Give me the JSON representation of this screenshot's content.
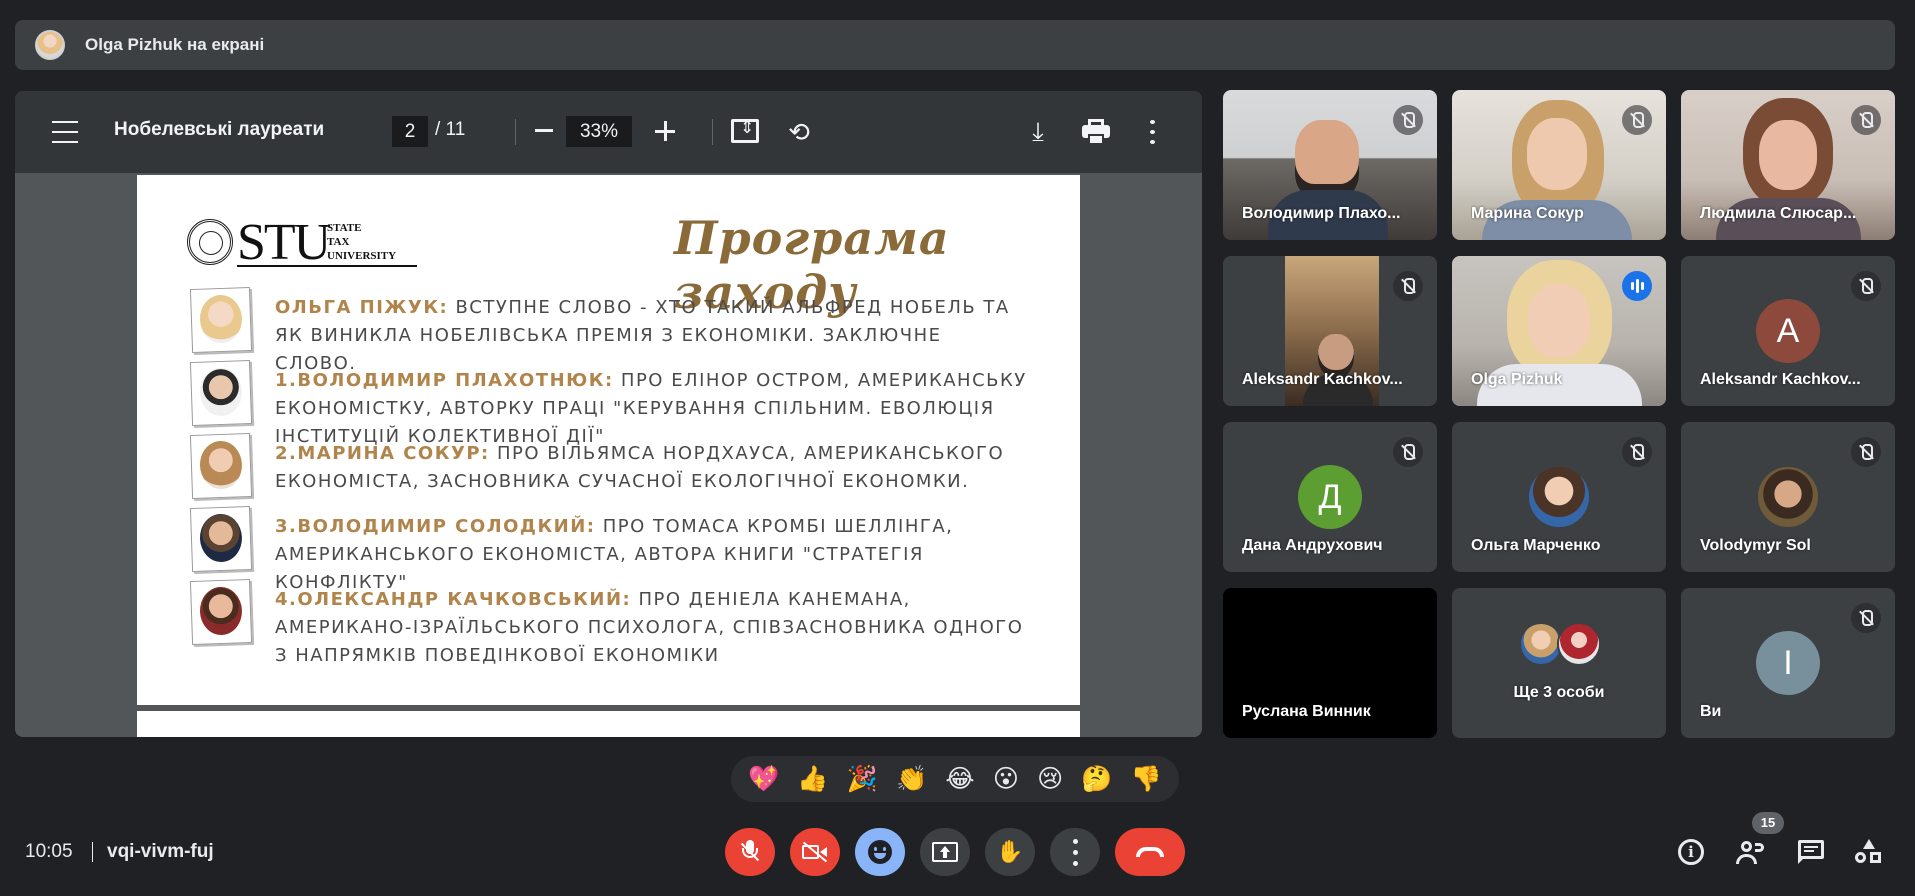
{
  "banner": {
    "text": "Olga Pizhuk на екрані"
  },
  "pdf": {
    "title": "Нобелевські лауреати",
    "page_current": "2",
    "page_total": "/ 11",
    "zoom": "33%",
    "slide": {
      "logo_text": "STU",
      "logo_sub_1": "STATE",
      "logo_sub_2": "TAX",
      "logo_sub_3": "UNIVERSITY",
      "title": "Програма заходу",
      "items": [
        {
          "speaker": "Ольга Піжук:",
          "text": " вступне слово - хто такий Альфред Нобель та як виникла Нобелівська премія з економіки. Заключне слово."
        },
        {
          "speaker": "1.Володимир Плахотнюк:",
          "text": " Про Елінор Остром, американську економістку, авторку праці \"Керування спільним. Еволюція інституцій колективної дії\""
        },
        {
          "speaker": "2.Марина Сокур:",
          "text": " про Вільямса Нордхауса, американського економіста, засновника сучасної екологічної економки."
        },
        {
          "speaker": "3.Володимир Солодкий:",
          "text": " про Томаса Кромбі Шеллінга, американського економіста, автора книги \"Стратегія конфлікту\""
        },
        {
          "speaker": "4.Олександр Качковський:",
          "text": " про Деніела Канемана, американо-ізраїльського психолога, співзасновника одного з напрямків поведінкової економіки"
        }
      ]
    }
  },
  "participants": [
    {
      "name": "Володимир Плахо..."
    },
    {
      "name": "Марина Сокур"
    },
    {
      "name": "Людмила Слюсар..."
    },
    {
      "name": "Aleksandr Kachkov..."
    },
    {
      "name": "Olga Pizhuk"
    },
    {
      "name": "Aleksandr Kachkov...",
      "initial": "A",
      "color": "#8d4a3c"
    },
    {
      "name": "Дана Андрухович",
      "initial": "Д",
      "color": "#5c9e31"
    },
    {
      "name": "Ольга Марченко"
    },
    {
      "name": "Volodymyr Sol"
    },
    {
      "name": "Руслана Винник"
    },
    {
      "name": "Ще 3 особи"
    },
    {
      "name": "Ви",
      "initial": "I",
      "color": "#78909c"
    }
  ],
  "reactions": [
    "💖",
    "👍",
    "🎉",
    "👏",
    "😂",
    "😮",
    "😢",
    "🤔",
    "👎"
  ],
  "bottom": {
    "time": "10:05",
    "meeting_code": "vqi-vivm-fuj",
    "participant_count": "15"
  }
}
